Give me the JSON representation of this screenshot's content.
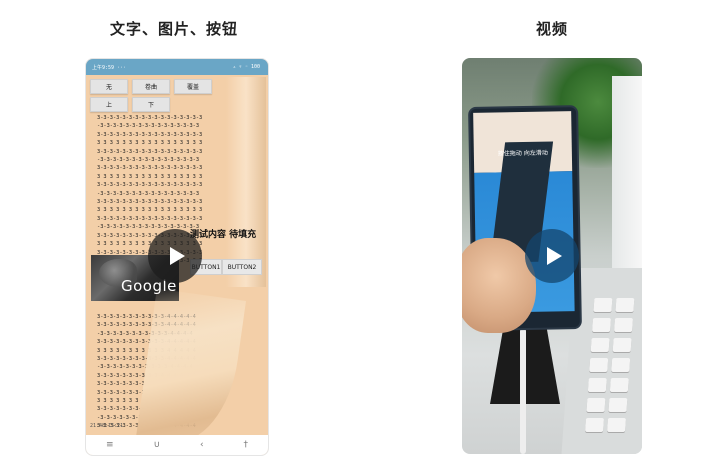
{
  "left_panel": {
    "title": "文字、图片、按钮",
    "status_left": "上午9:59 ···",
    "status_right": "▵ ▿ ◦ 100",
    "buttons_row1": [
      "无",
      "卷曲",
      "覆盖"
    ],
    "buttons_row2": [
      "上",
      "下"
    ],
    "text_lines_top": [
      "3-3-3-3-3-3-3-3-3-3-3-3-3-3-3-3-3",
      "-3-3-3-3-3-3-3-3-3-3-3-3-3-3-3-3",
      "3-3-3-3-3-3-3-3-3-3-3-3-3-3-3-3-3",
      "3 3 3 3 3 3 3 3 3 3 3 3 3 3 3 3 3",
      "3-3-3-3-3-3-3-3-3-3-3-3-3-3-3-3-3",
      "-3-3-3-3-3-3-3-3-3-3-3-3-3-3-3-3",
      "3-3-3-3-3-3-3-3-3-3-3-3-3-3-3-3-3",
      "3 3 3 3 3 3 3 3 3 3 3 3 3 3 3 3 3",
      "3-3-3-3-3-3-3-3-3-3-3-3-3-3-3-3-3",
      "-3-3-3-3-3-3-3-3-3-3-3-3-3-3-3-3",
      "3-3-3-3-3-3-3-3-3-3-3-3-3-3-3-3-3",
      "3 3 3 3 3 3 3 3 3 3 3 3 3 3 3 3 3",
      "3-3-3-3-3-3-3-3-3-3-3-3-3-3-3-3-3",
      "-3-3-3-3-3-3-3-3-3-3-3-3-3-3-3-3",
      "3-3-3-3-3-3-3-3-3-3-3-3-3-3-3-3-3",
      "3 3 3 3 3 3 3 3 3 3 3 3 3 3 3 3 3",
      "3-3-3-3-3-3-3-3-3-3-3-3-3-3-3-3-3",
      "3-3-3-3-3-3-3-3-3-3-3-3-3-3-3-3-3"
    ],
    "test_text": "测试内容 待填充",
    "image_text": "Google",
    "button1_label": "BUTTON1",
    "button2_label": "BUTTON2",
    "text_lines_bottom": [
      "3-3-3-3-3-3-3-3-3-3-3-4-4-4-4-4",
      "3-3-3-3-3-3-3-3-3-3-3-4-4-4-4-4",
      "-3-3-3-3-3-3-3-3-3-3-3-4-4-4-4",
      "3-3-3-3-3-3-3-3-3-3-3-4-4-4-4-4",
      "3 3 3 3 3 3 3 3 3 3 3 4 4 4 4 4",
      "3-3-3-3-3-3-3-3-3-3-3-4-4-4-4-4",
      "-3-3-3-3-3-3-3-3-3-3-3-4-4-4-4",
      "3-3-3-3-3-3-3-3-3-3-4-4-4-4-4-4",
      "3-3-3-3-3-3-3-3-3-3-4-4-4-4-4-4",
      "3-3-3-3-3-3-3-3-3-3-4-4-4-4-4-4",
      "3 3 3 3 3 3 3 3 3 3 4 4 4 4 4 4",
      "3-3-3-3-3-3-3-3-3-3-4-4-4-4-4-4",
      "-3-3-3-3-3-3-3-3-3-4-4-4-4-4-4",
      "3-3-3-3-3-3-3-3-3-4-4-4-4-4-4-4"
    ],
    "time_footer": "21:48:15:21",
    "nav_icons": [
      "≡",
      "∪",
      "‹",
      "†"
    ]
  },
  "right_panel": {
    "title": "视频",
    "held_phone_text": "按住拖动 向左滑动"
  }
}
